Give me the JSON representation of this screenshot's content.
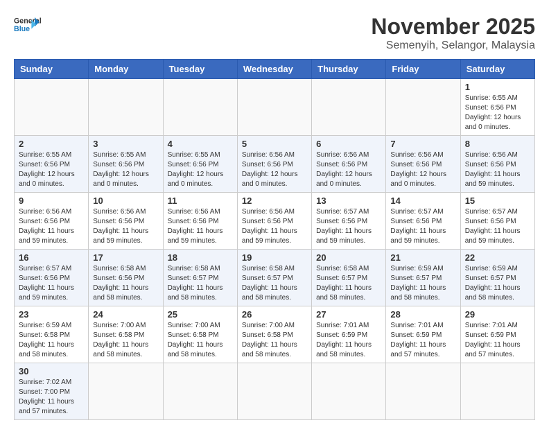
{
  "header": {
    "logo_general": "General",
    "logo_blue": "Blue",
    "month_title": "November 2025",
    "location": "Semenyih, Selangor, Malaysia"
  },
  "weekdays": [
    "Sunday",
    "Monday",
    "Tuesday",
    "Wednesday",
    "Thursday",
    "Friday",
    "Saturday"
  ],
  "weeks": [
    [
      {
        "day": "",
        "info": ""
      },
      {
        "day": "",
        "info": ""
      },
      {
        "day": "",
        "info": ""
      },
      {
        "day": "",
        "info": ""
      },
      {
        "day": "",
        "info": ""
      },
      {
        "day": "",
        "info": ""
      },
      {
        "day": "1",
        "info": "Sunrise: 6:55 AM\nSunset: 6:56 PM\nDaylight: 12 hours\nand 0 minutes."
      }
    ],
    [
      {
        "day": "2",
        "info": "Sunrise: 6:55 AM\nSunset: 6:56 PM\nDaylight: 12 hours\nand 0 minutes."
      },
      {
        "day": "3",
        "info": "Sunrise: 6:55 AM\nSunset: 6:56 PM\nDaylight: 12 hours\nand 0 minutes."
      },
      {
        "day": "4",
        "info": "Sunrise: 6:55 AM\nSunset: 6:56 PM\nDaylight: 12 hours\nand 0 minutes."
      },
      {
        "day": "5",
        "info": "Sunrise: 6:56 AM\nSunset: 6:56 PM\nDaylight: 12 hours\nand 0 minutes."
      },
      {
        "day": "6",
        "info": "Sunrise: 6:56 AM\nSunset: 6:56 PM\nDaylight: 12 hours\nand 0 minutes."
      },
      {
        "day": "7",
        "info": "Sunrise: 6:56 AM\nSunset: 6:56 PM\nDaylight: 12 hours\nand 0 minutes."
      },
      {
        "day": "8",
        "info": "Sunrise: 6:56 AM\nSunset: 6:56 PM\nDaylight: 11 hours\nand 59 minutes."
      }
    ],
    [
      {
        "day": "9",
        "info": "Sunrise: 6:56 AM\nSunset: 6:56 PM\nDaylight: 11 hours\nand 59 minutes."
      },
      {
        "day": "10",
        "info": "Sunrise: 6:56 AM\nSunset: 6:56 PM\nDaylight: 11 hours\nand 59 minutes."
      },
      {
        "day": "11",
        "info": "Sunrise: 6:56 AM\nSunset: 6:56 PM\nDaylight: 11 hours\nand 59 minutes."
      },
      {
        "day": "12",
        "info": "Sunrise: 6:56 AM\nSunset: 6:56 PM\nDaylight: 11 hours\nand 59 minutes."
      },
      {
        "day": "13",
        "info": "Sunrise: 6:57 AM\nSunset: 6:56 PM\nDaylight: 11 hours\nand 59 minutes."
      },
      {
        "day": "14",
        "info": "Sunrise: 6:57 AM\nSunset: 6:56 PM\nDaylight: 11 hours\nand 59 minutes."
      },
      {
        "day": "15",
        "info": "Sunrise: 6:57 AM\nSunset: 6:56 PM\nDaylight: 11 hours\nand 59 minutes."
      }
    ],
    [
      {
        "day": "16",
        "info": "Sunrise: 6:57 AM\nSunset: 6:56 PM\nDaylight: 11 hours\nand 59 minutes."
      },
      {
        "day": "17",
        "info": "Sunrise: 6:58 AM\nSunset: 6:56 PM\nDaylight: 11 hours\nand 58 minutes."
      },
      {
        "day": "18",
        "info": "Sunrise: 6:58 AM\nSunset: 6:57 PM\nDaylight: 11 hours\nand 58 minutes."
      },
      {
        "day": "19",
        "info": "Sunrise: 6:58 AM\nSunset: 6:57 PM\nDaylight: 11 hours\nand 58 minutes."
      },
      {
        "day": "20",
        "info": "Sunrise: 6:58 AM\nSunset: 6:57 PM\nDaylight: 11 hours\nand 58 minutes."
      },
      {
        "day": "21",
        "info": "Sunrise: 6:59 AM\nSunset: 6:57 PM\nDaylight: 11 hours\nand 58 minutes."
      },
      {
        "day": "22",
        "info": "Sunrise: 6:59 AM\nSunset: 6:57 PM\nDaylight: 11 hours\nand 58 minutes."
      }
    ],
    [
      {
        "day": "23",
        "info": "Sunrise: 6:59 AM\nSunset: 6:58 PM\nDaylight: 11 hours\nand 58 minutes."
      },
      {
        "day": "24",
        "info": "Sunrise: 7:00 AM\nSunset: 6:58 PM\nDaylight: 11 hours\nand 58 minutes."
      },
      {
        "day": "25",
        "info": "Sunrise: 7:00 AM\nSunset: 6:58 PM\nDaylight: 11 hours\nand 58 minutes."
      },
      {
        "day": "26",
        "info": "Sunrise: 7:00 AM\nSunset: 6:58 PM\nDaylight: 11 hours\nand 58 minutes."
      },
      {
        "day": "27",
        "info": "Sunrise: 7:01 AM\nSunset: 6:59 PM\nDaylight: 11 hours\nand 58 minutes."
      },
      {
        "day": "28",
        "info": "Sunrise: 7:01 AM\nSunset: 6:59 PM\nDaylight: 11 hours\nand 57 minutes."
      },
      {
        "day": "29",
        "info": "Sunrise: 7:01 AM\nSunset: 6:59 PM\nDaylight: 11 hours\nand 57 minutes."
      }
    ],
    [
      {
        "day": "30",
        "info": "Sunrise: 7:02 AM\nSunset: 7:00 PM\nDaylight: 11 hours\nand 57 minutes."
      },
      {
        "day": "",
        "info": ""
      },
      {
        "day": "",
        "info": ""
      },
      {
        "day": "",
        "info": ""
      },
      {
        "day": "",
        "info": ""
      },
      {
        "day": "",
        "info": ""
      },
      {
        "day": "",
        "info": ""
      }
    ]
  ]
}
